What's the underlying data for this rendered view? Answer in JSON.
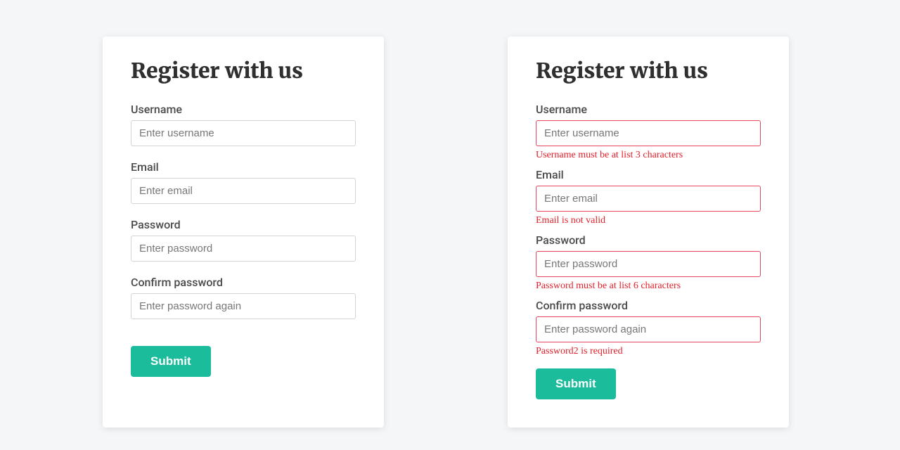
{
  "form_left": {
    "title": "Register with us",
    "fields": {
      "username": {
        "label": "Username",
        "placeholder": "Enter username"
      },
      "email": {
        "label": "Email",
        "placeholder": "Enter email"
      },
      "password": {
        "label": "Password",
        "placeholder": "Enter password"
      },
      "confirm_password": {
        "label": "Confirm password",
        "placeholder": "Enter password again"
      }
    },
    "submit_label": "Submit"
  },
  "form_right": {
    "title": "Register with us",
    "fields": {
      "username": {
        "label": "Username",
        "placeholder": "Enter username",
        "error": "Username must be at list 3 characters"
      },
      "email": {
        "label": "Email",
        "placeholder": "Enter email",
        "error": "Email is not valid"
      },
      "password": {
        "label": "Password",
        "placeholder": "Enter password",
        "error": "Password must be at list 6 characters"
      },
      "confirm_password": {
        "label": "Confirm password",
        "placeholder": "Enter password again",
        "error": "Password2 is required"
      }
    },
    "submit_label": "Submit"
  },
  "colors": {
    "accent": "#1abc9c",
    "error": "#e4202a"
  }
}
